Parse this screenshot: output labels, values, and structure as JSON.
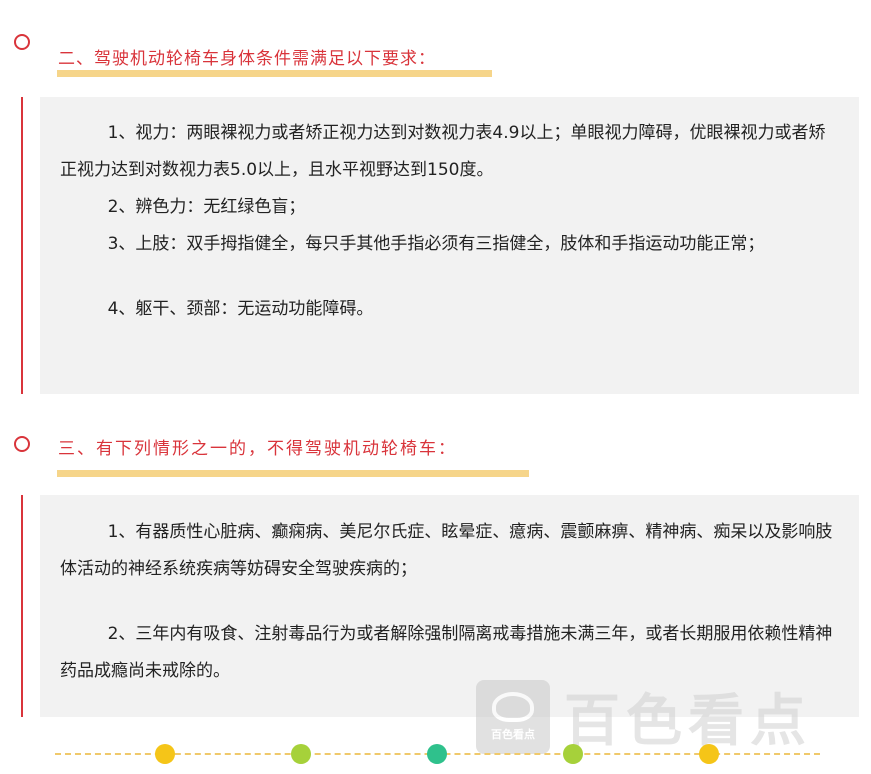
{
  "section2": {
    "heading": "二、驾驶机动轮椅车身体条件需满足以下要求：",
    "paragraphs": [
      "1、视力：两眼裸视力或者矫正视力达到对数视力表4.9以上；单眼视力障碍，优眼裸视力或者矫正视力达到对数视力表5.0以上，且水平视野达到150度。",
      "2、辨色力：无红绿色盲；",
      "3、上肢：双手拇指健全，每只手其他手指必须有三指健全，肢体和手指运动功能正常；",
      "4、躯干、颈部：无运动功能障碍。"
    ]
  },
  "section3": {
    "heading": "三、有下列情形之一的，不得驾驶机动轮椅车：",
    "paragraphs": [
      "1、有器质性心脏病、癫痫病、美尼尔氏症、眩晕症、癔病、震颤麻痹、精神病、痴呆以及影响肢体活动的神经系统疾病等妨碍安全驾驶疾病的；",
      "2、三年内有吸食、注射毒品行为或者解除强制隔离戒毒措施未满三年，或者长期服用依赖性精神药品成瘾尚未戒除的。"
    ]
  },
  "watermark": {
    "logo_text": "百色看点",
    "brand_text": "百色看点"
  },
  "colors": {
    "accent_red": "#d9343b",
    "underline_gold": "#f6d58a",
    "panel_gray": "#f2f2f2",
    "dot_yellow": "#f5c518",
    "dot_green": "#a6d13a",
    "dot_teal": "#2fc18c"
  }
}
